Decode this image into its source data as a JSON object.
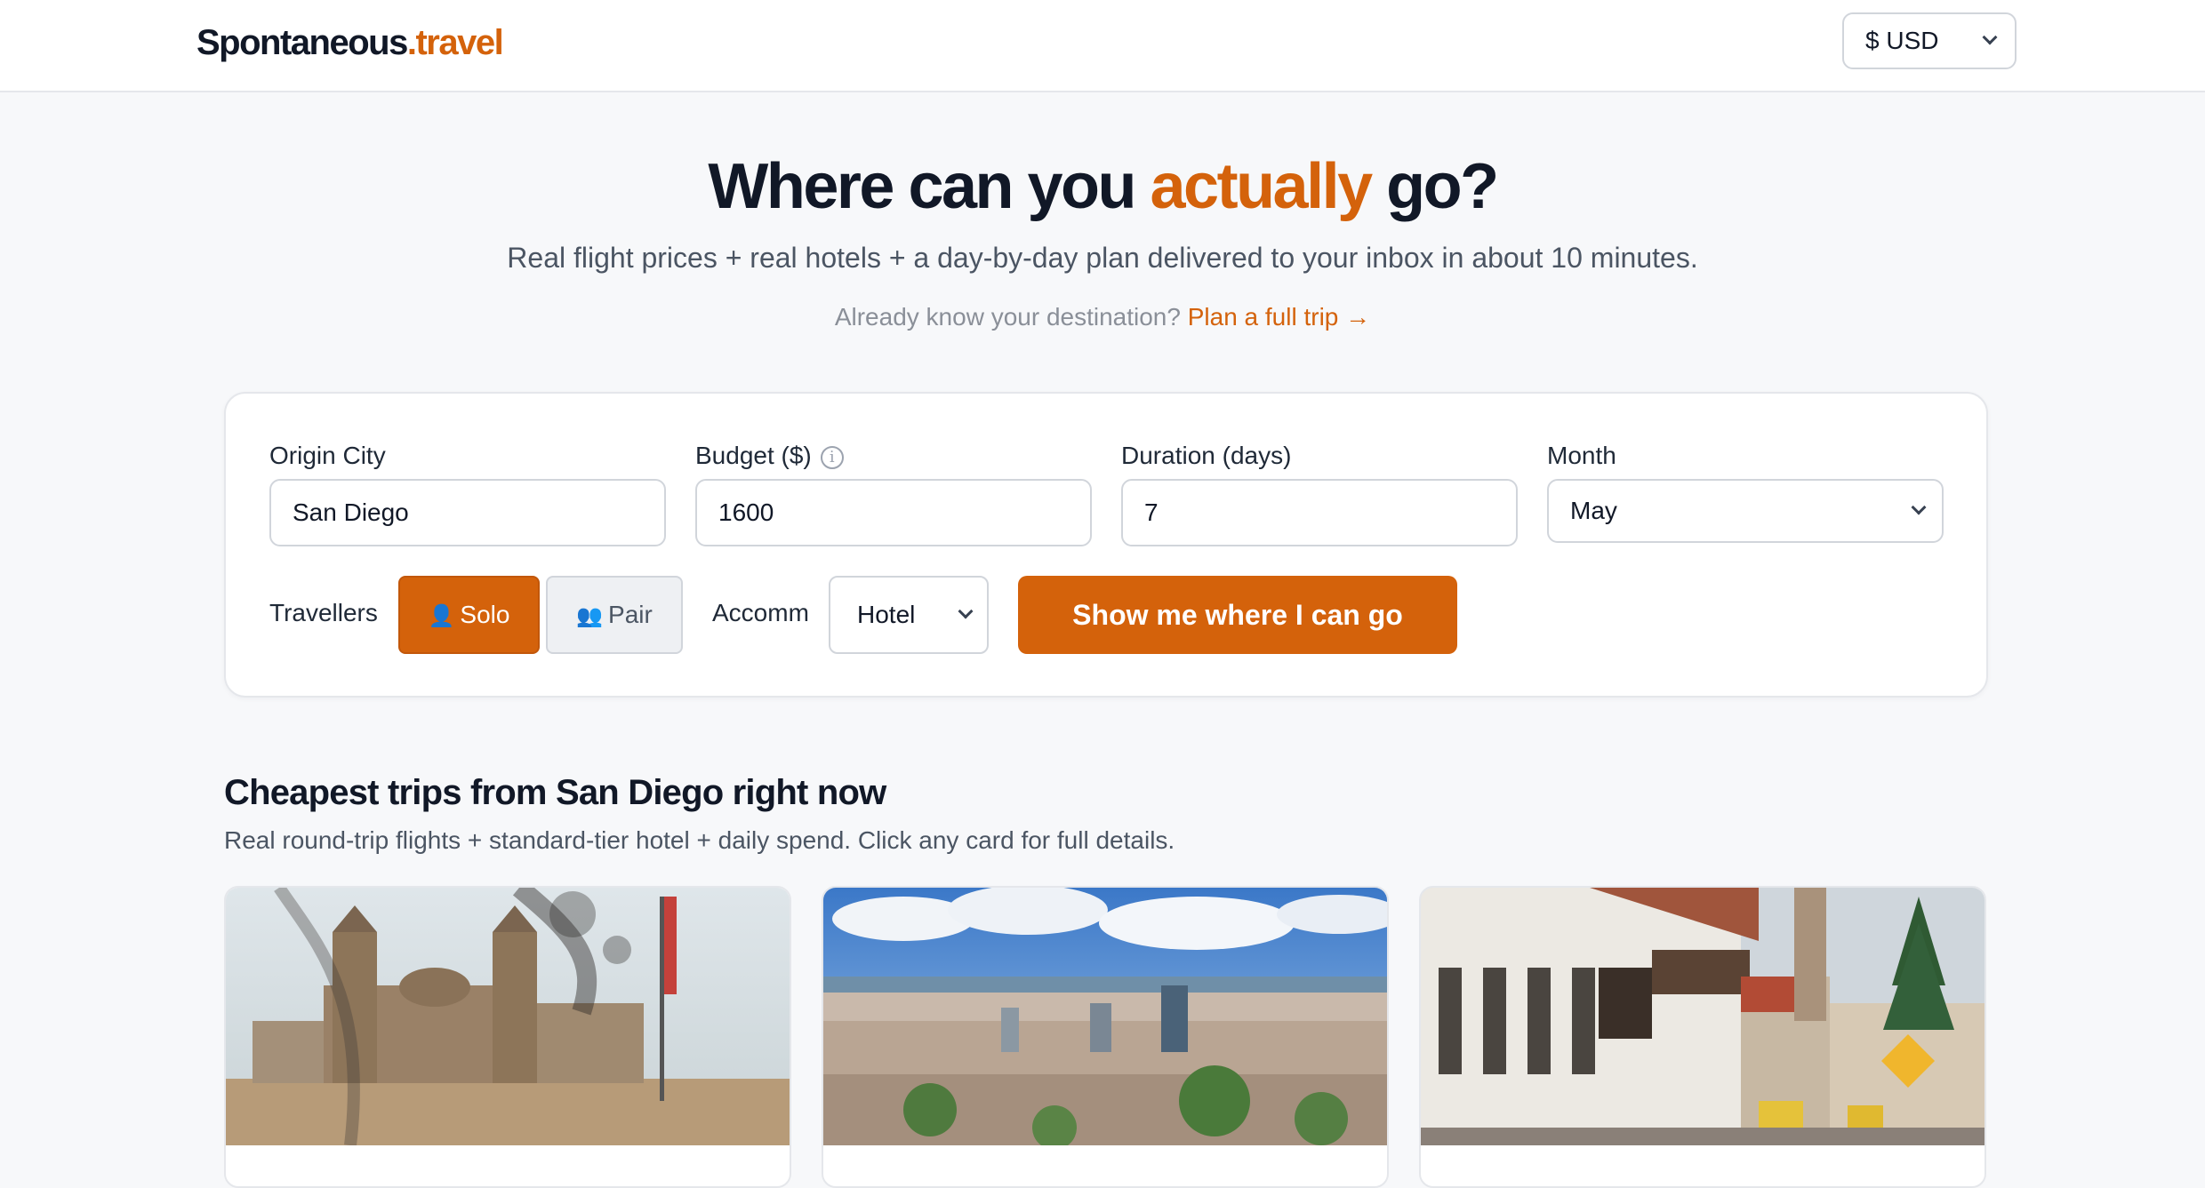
{
  "header": {
    "logo_main": "Spontaneous",
    "logo_accent": ".travel",
    "currency": "$ USD"
  },
  "hero": {
    "title_pre": "Where can you ",
    "title_accent": "actually",
    "title_post": " go?",
    "subtitle": "Real flight prices + real hotels + a day-by-day plan delivered to your inbox in about 10 minutes.",
    "know_text": "Already know your destination?",
    "know_link": "Plan a full trip →"
  },
  "form": {
    "origin": {
      "label": "Origin City",
      "value": "San Diego"
    },
    "budget": {
      "label": "Budget ($)",
      "value": "1600"
    },
    "duration": {
      "label": "Duration (days)",
      "value": "7"
    },
    "month": {
      "label": "Month",
      "value": "May"
    },
    "travellers_label": "Travellers",
    "solo_label": "Solo",
    "pair_label": "Pair",
    "accomm_label": "Accomm",
    "accomm_value": "Hotel",
    "submit": "Show me where I can go"
  },
  "trips": {
    "title": "Cheapest trips from San Diego right now",
    "subtitle": "Real round-trip flights + standard-tier hotel + daily spend. Click any card for full details."
  },
  "colors": {
    "accent": "#d4620b",
    "text": "#111827",
    "muted": "#4b5563",
    "page_bg": "#f7f8fa"
  },
  "icons": {
    "currency_chevron": "chevron-down-icon",
    "budget_info": "info-icon",
    "solo": "person-icon",
    "pair": "people-icon"
  }
}
